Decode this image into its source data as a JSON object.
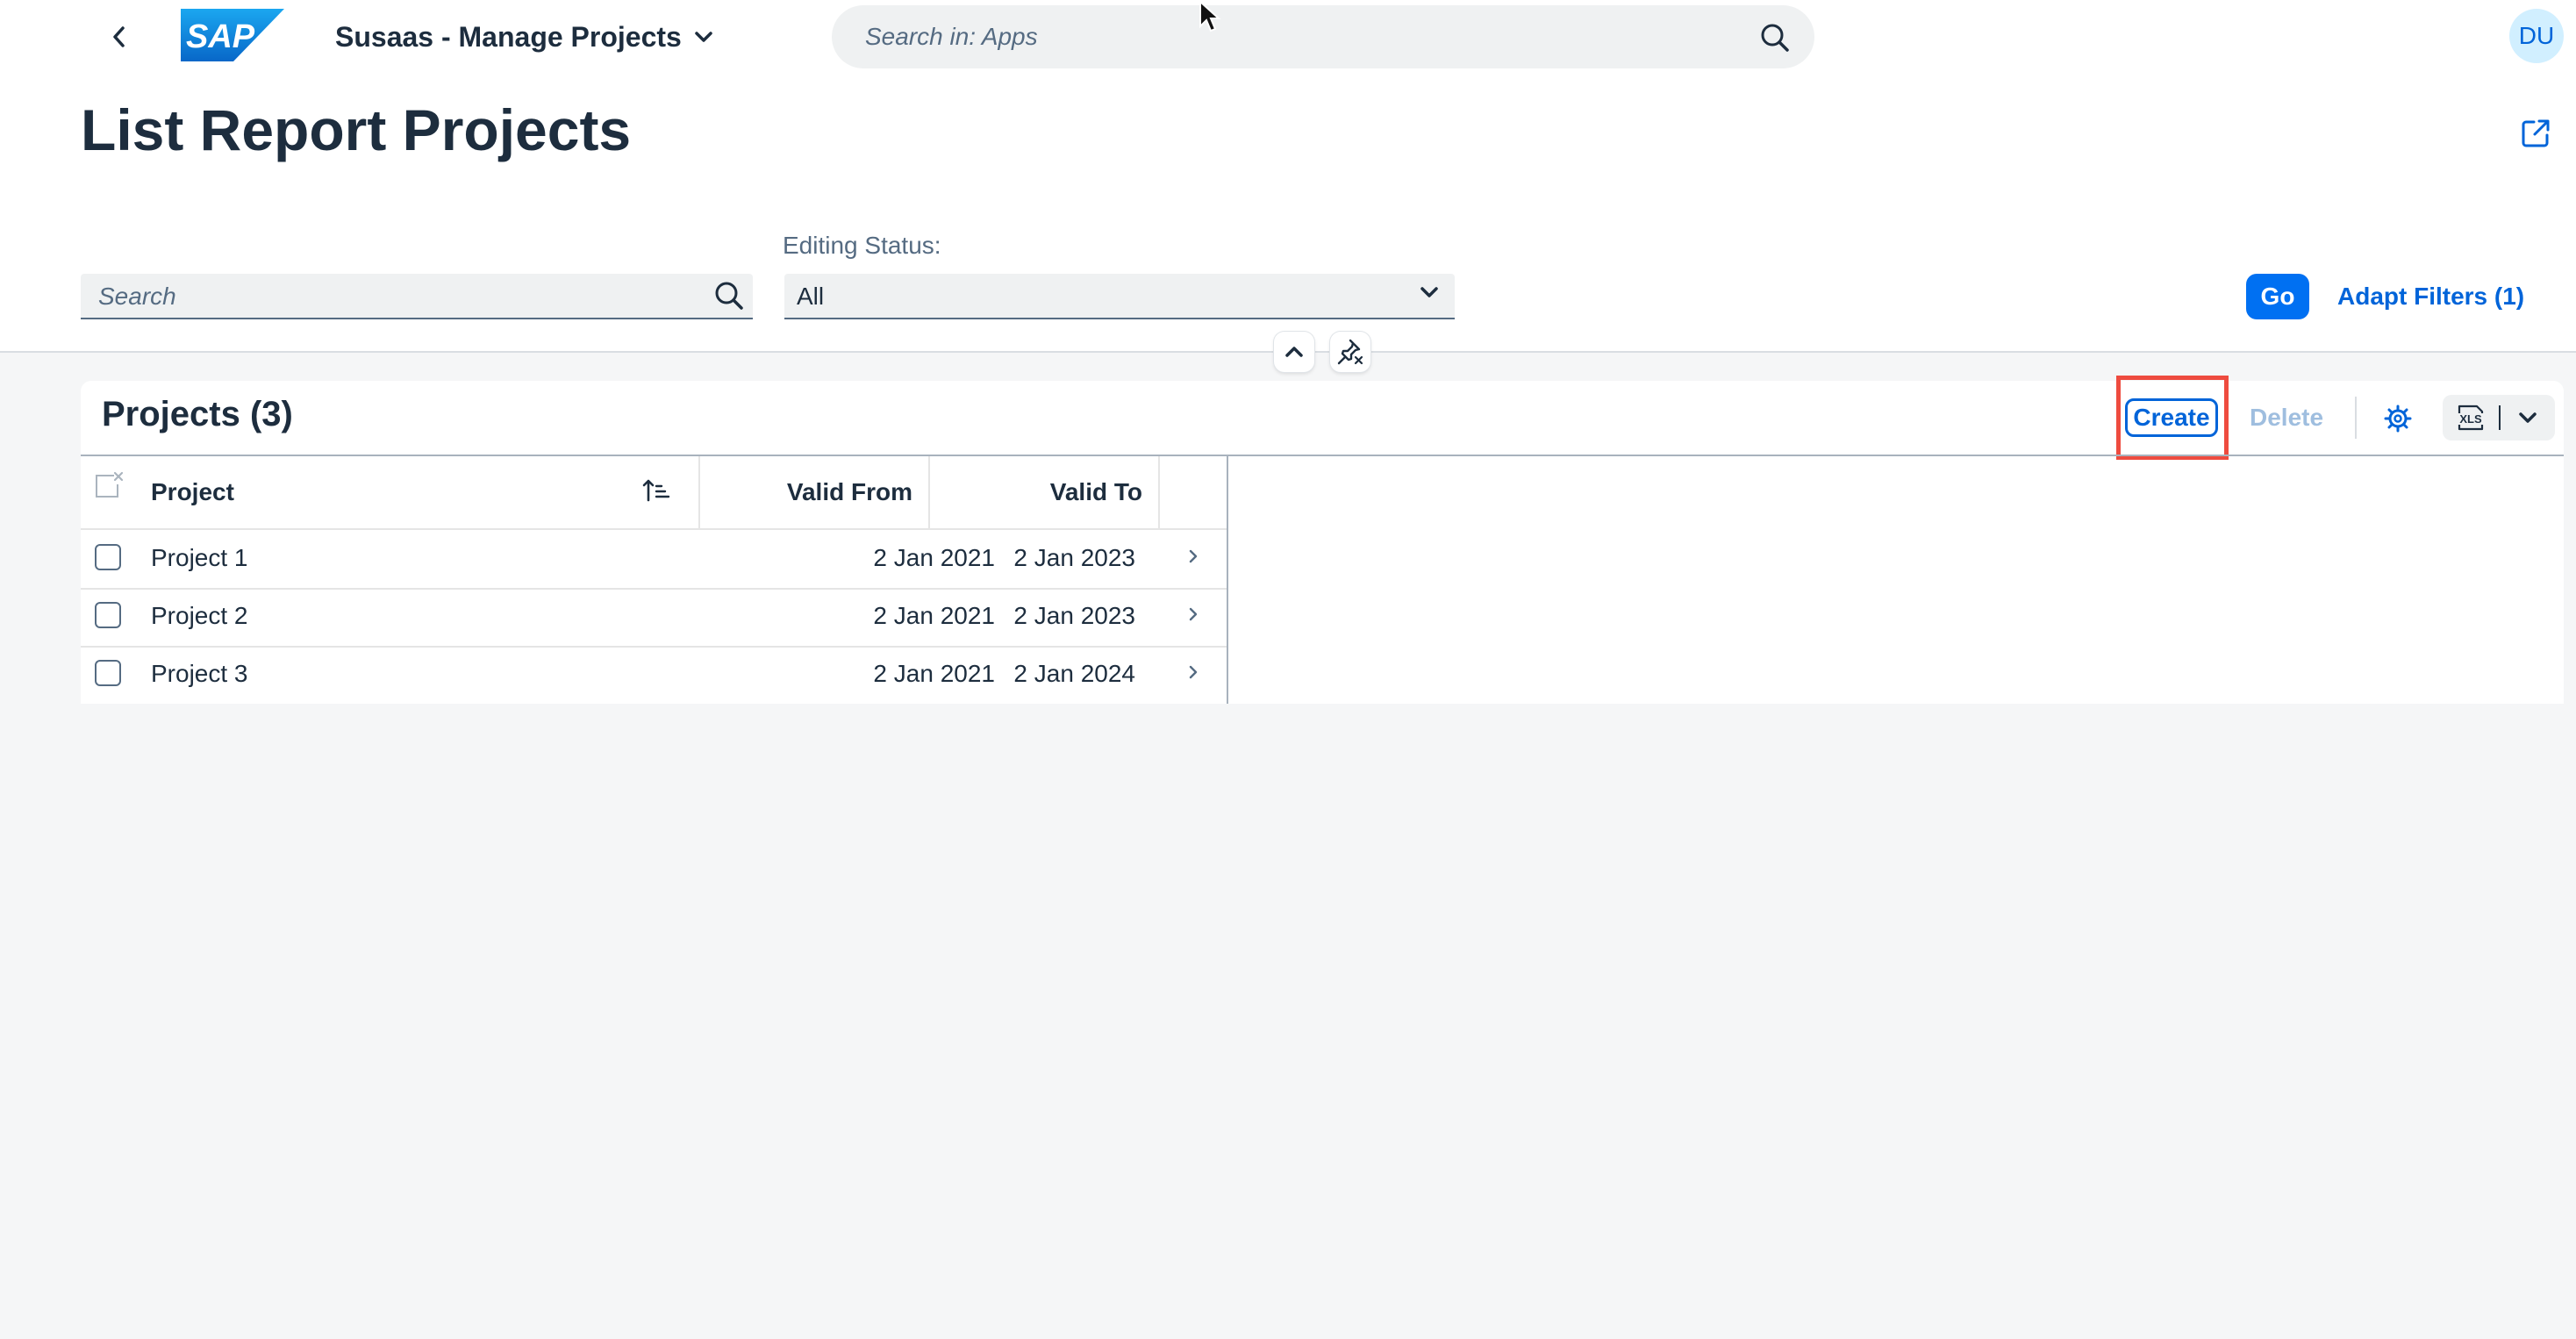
{
  "shell": {
    "app_title": "Susaas - Manage Projects",
    "search_placeholder": "Search in: Apps",
    "avatar_initials": "DU",
    "logo_text": "SAP"
  },
  "page": {
    "title": "List Report Projects"
  },
  "filters": {
    "search_placeholder": "Search",
    "editing_status_label": "Editing Status:",
    "editing_status_value": "All",
    "go_label": "Go",
    "adapt_label": "Adapt Filters (1)"
  },
  "table": {
    "title": "Projects (3)",
    "toolbar": {
      "create_label": "Create",
      "delete_label": "Delete",
      "export_label": "XLS"
    },
    "columns": {
      "project": "Project",
      "valid_from": "Valid From",
      "valid_to": "Valid To"
    },
    "rows": [
      {
        "project": "Project 1",
        "valid_from": "2 Jan 2021",
        "valid_to": "2 Jan 2023"
      },
      {
        "project": "Project 2",
        "valid_from": "2 Jan 2021",
        "valid_to": "2 Jan 2023"
      },
      {
        "project": "Project 3",
        "valid_from": "2 Jan 2021",
        "valid_to": "2 Jan 2024"
      }
    ]
  },
  "colors": {
    "brand_blue": "#0070f2",
    "link_blue": "#0064d9",
    "highlight_red": "#ee4b3f",
    "text_dark": "#1d2d3e",
    "background": "#f5f6f7"
  },
  "icons": [
    "back-icon",
    "sap-logo",
    "chevron-down-icon",
    "search-icon",
    "share-icon",
    "collapse-up-icon",
    "unpin-icon",
    "settings-icon",
    "xls-export-icon",
    "row-navigation-icon",
    "clear-selection-icon",
    "sort-ascending-icon",
    "mouse-cursor-icon"
  ]
}
